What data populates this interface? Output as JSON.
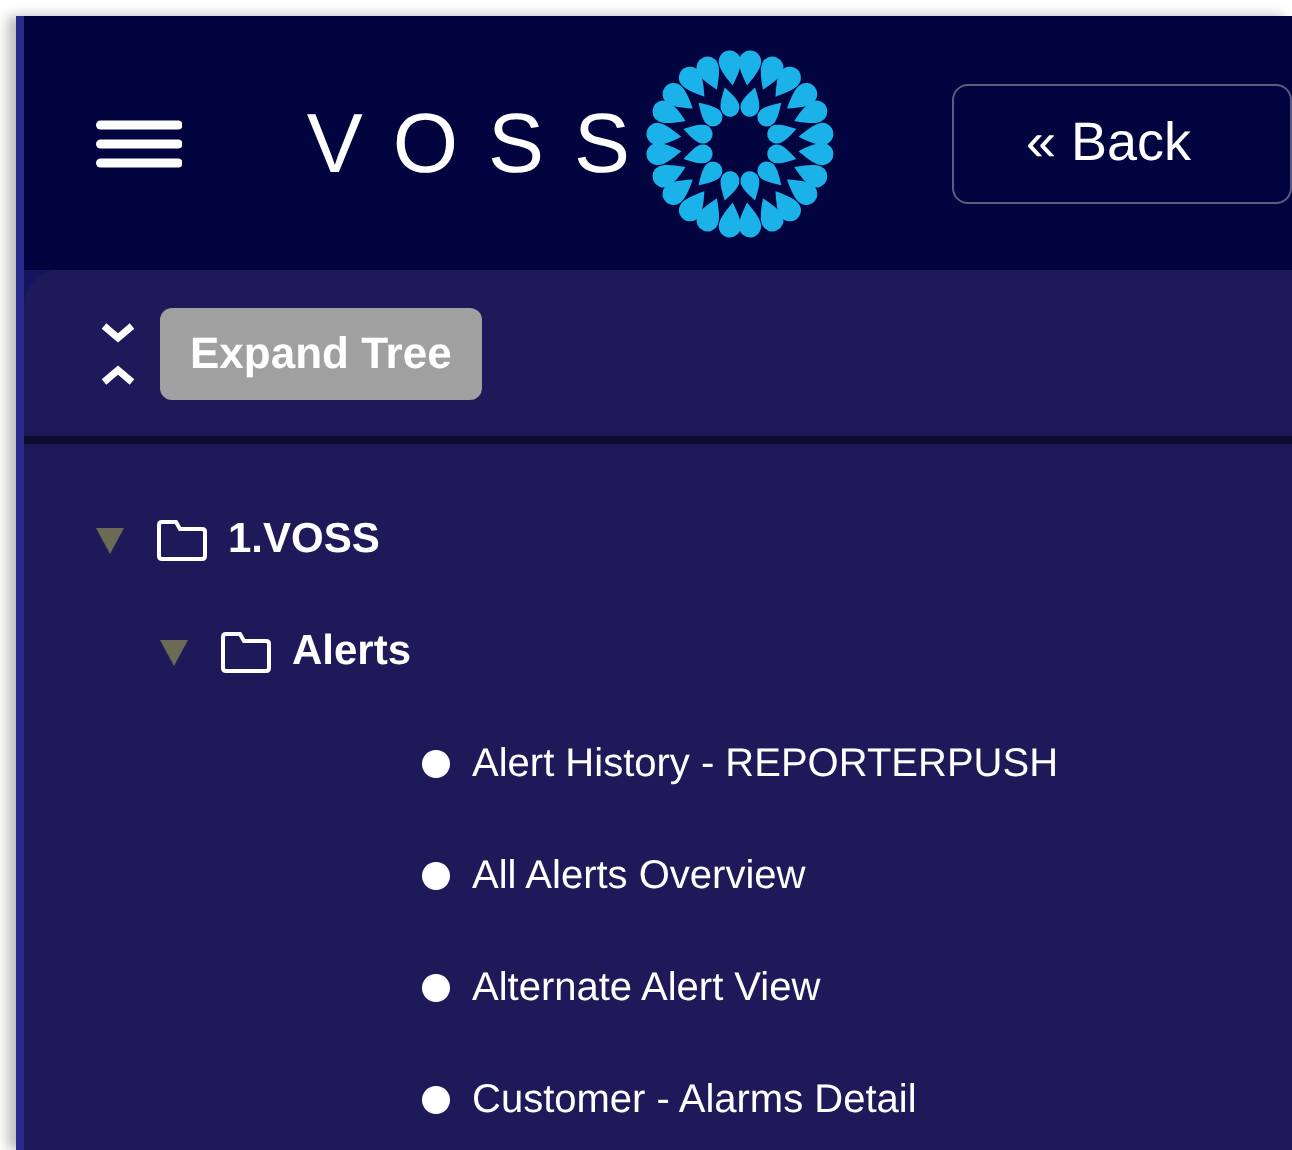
{
  "header": {
    "logo_text": "VOSS",
    "back_button": "« Back"
  },
  "toolbar": {
    "tooltip": "Expand Tree"
  },
  "tree": [
    {
      "kind": "folder",
      "label": "1.VOSS",
      "expanded": true,
      "children": [
        {
          "kind": "folder",
          "label": "Alerts",
          "expanded": true,
          "children": [
            {
              "kind": "item",
              "label": "Alert History - REPORTERPUSH"
            },
            {
              "kind": "item",
              "label": "All Alerts Overview"
            },
            {
              "kind": "item",
              "label": "Alternate Alert View"
            },
            {
              "kind": "item",
              "label": "Customer - Alarms Detail"
            }
          ]
        }
      ]
    }
  ]
}
